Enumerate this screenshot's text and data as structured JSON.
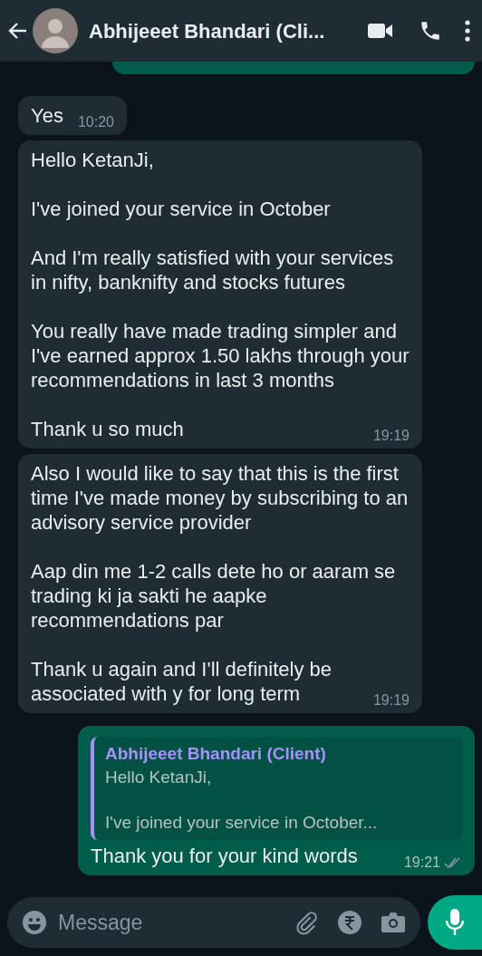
{
  "header": {
    "title": "Abhijeeet Bhandari (Cli..."
  },
  "messages": [
    {
      "kind": "incoming",
      "paragraphs": [
        "Yes"
      ],
      "time": "10:20"
    },
    {
      "kind": "incoming",
      "paragraphs": [
        "Hello KetanJi,",
        "I've joined your service in October",
        "And I'm really satisfied with your services in nifty, banknifty and stocks futures",
        "You really have made trading simpler and I've earned approx 1.50 lakhs through your recommendations in last 3 months",
        "Thank u so much"
      ],
      "time": "19:19"
    },
    {
      "kind": "incoming",
      "paragraphs": [
        "Also I would like to say that this is the first time I've made money by subscribing to an advisory service provider",
        "Aap din me 1-2 calls dete ho or aaram se trading ki ja sakti he aapke recommendations par",
        "Thank u again and I'll definitely be associated with y for long term"
      ],
      "time": "19:19"
    },
    {
      "kind": "outgoing",
      "quote": {
        "author": "Abhijeeet Bhandari (Client)",
        "lines": [
          "Hello KetanJi,",
          "I've joined your service in October..."
        ]
      },
      "paragraphs": [
        "Thank you for your kind words"
      ],
      "time": "19:21",
      "read": false
    }
  ],
  "composer": {
    "placeholder": "Message"
  }
}
